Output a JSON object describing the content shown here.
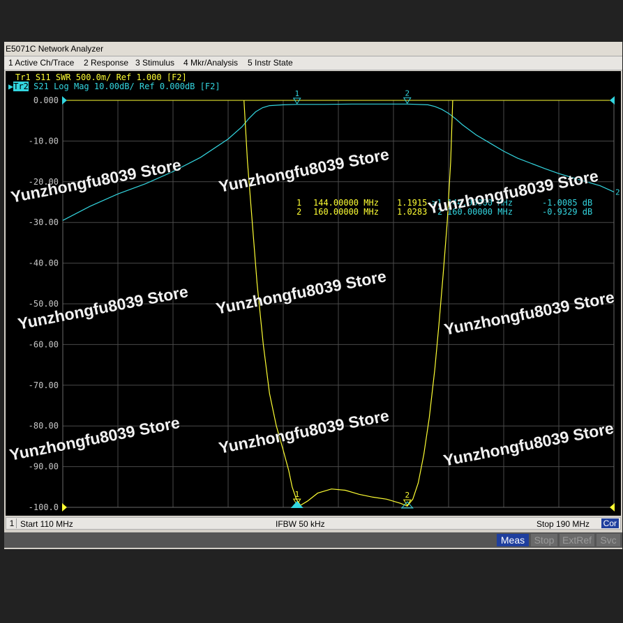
{
  "window": {
    "title": "E5071C Network Analyzer"
  },
  "menu": {
    "items": [
      {
        "label": "1 Active Ch/Trace"
      },
      {
        "label": "2 Response"
      },
      {
        "label": "3 Stimulus"
      },
      {
        "label": "4 Mkr/Analysis"
      },
      {
        "label": "5 Instr State"
      }
    ]
  },
  "traces": [
    {
      "id": "Tr1",
      "param": "S11",
      "format": "SWR",
      "scale": "500.0m/",
      "ref": "Ref 1.000",
      "flag": "[F2]",
      "color": "#ffff33"
    },
    {
      "id": "Tr2",
      "param": "S21",
      "format": "Log Mag",
      "scale": "10.00dB/",
      "ref": "Ref 0.000dB",
      "flag": "[F2]",
      "color": "#33d6e0",
      "active": true
    }
  ],
  "markers": {
    "tr1": [
      {
        "num": "1",
        "freq": "144.00000 MHz",
        "value": "1.1915"
      },
      {
        "num": "2",
        "freq": "160.00000 MHz",
        "value": "1.0283"
      }
    ],
    "tr2": [
      {
        "num": ">1",
        "freq": "144.00000 MHz",
        "value": "-1.0085 dB"
      },
      {
        "num": "2",
        "freq": "160.00000 MHz",
        "value": "-0.9329 dB"
      }
    ]
  },
  "status": {
    "channel": "1",
    "start": "Start 110 MHz",
    "ifbw": "IFBW 50 kHz",
    "stop": "Stop 190 MHz",
    "cor": "Cor"
  },
  "softkeys": [
    {
      "label": "Meas"
    },
    {
      "label": "Stop"
    },
    {
      "label": "ExtRef"
    },
    {
      "label": "Svc"
    }
  ],
  "watermarks": [
    "Yunzhongfu8039 Store",
    "Yunzhongfu8039 Store",
    "Yunzhongfu8039 Store",
    "Yunzhongfu8039 Store",
    "Yunzhongfu8039 Store",
    "Yunzhongfu8039 Store",
    "Yunzhongfu8039 Store",
    "Yunzhongfu8039 Store",
    "Yunzhongfu8039 Store",
    "Yunzhongfu8039 Store"
  ],
  "chart_data": {
    "type": "line",
    "x_unit": "MHz",
    "xlim": [
      110,
      190
    ],
    "ylim": [
      -100,
      0
    ],
    "grid": true,
    "y_tick_labels": [
      "0.000",
      "-10.00",
      "-20.00",
      "-30.00",
      "-40.00",
      "-50.00",
      "-60.00",
      "-70.00",
      "-80.00",
      "-90.00",
      "-100.0"
    ],
    "series": [
      {
        "name": "Tr2 S21 Log Mag",
        "color": "#33d6e0",
        "x": [
          110,
          114,
          118,
          122,
          126,
          130,
          134,
          136,
          137,
          138,
          139,
          140,
          142,
          144,
          148,
          152,
          156,
          160,
          163,
          164,
          165,
          166,
          167,
          168,
          170,
          172,
          174,
          176,
          178,
          180,
          182,
          184,
          186,
          188,
          190
        ],
        "y": [
          -29.5,
          -26,
          -23,
          -20.5,
          -17.5,
          -14,
          -9.5,
          -6.5,
          -4.5,
          -2.8,
          -1.8,
          -1.3,
          -1.1,
          -1.0,
          -1.0,
          -0.9,
          -0.9,
          -0.9,
          -1.1,
          -1.5,
          -2.2,
          -3.2,
          -4.5,
          -6,
          -8.5,
          -10.5,
          -12.5,
          -14.2,
          -15.5,
          -16.8,
          -18,
          -19,
          -20,
          -21,
          -22.5
        ]
      },
      {
        "name": "Tr1 S11 SWR",
        "color": "#ffff33",
        "x": [
          136.3,
          136.8,
          137.5,
          138.2,
          139.1,
          140,
          141,
          142,
          142.8,
          143.3,
          143.9,
          144.5,
          145.5,
          147,
          149,
          151,
          153,
          155,
          157,
          159,
          160,
          160.8,
          161.6,
          162.4,
          163.2,
          164,
          164.6,
          165.2,
          165.8,
          166.3,
          166.6
        ],
        "y": [
          0,
          -15,
          -30,
          -45,
          -60,
          -72,
          -80,
          -86,
          -91,
          -95,
          -98,
          -99.5,
          -98.5,
          -96.5,
          -95.5,
          -95.8,
          -96.8,
          -97.5,
          -98,
          -99,
          -99.7,
          -98,
          -94,
          -87,
          -78,
          -66,
          -55,
          -43,
          -30,
          -15,
          0
        ]
      }
    ],
    "markers": [
      {
        "trace": "Tr1",
        "num": "1",
        "x": 144,
        "y": -99.5
      },
      {
        "trace": "Tr1",
        "num": "2",
        "x": 160,
        "y": -99.7
      },
      {
        "trace": "Tr2",
        "num": "1",
        "x": 144,
        "y": -1.0
      },
      {
        "trace": "Tr2",
        "num": "2",
        "x": 160,
        "y": -0.9
      }
    ]
  }
}
